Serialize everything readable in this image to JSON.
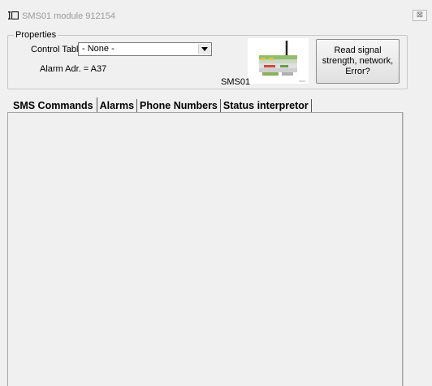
{
  "window": {
    "title": "SMS01 module 912154",
    "close_label": "⊠"
  },
  "properties": {
    "legend": "Properties",
    "control_table_label": "Control Table",
    "control_table_value": "- None -",
    "alarm_address_label": "Alarm Adr. = A37",
    "module_name": "SMS01",
    "read_button_label": "Read signal strength, network, Error?",
    "module_image_icon": "sms-module-icon"
  },
  "tabs": [
    {
      "label": "SMS Commands",
      "active": true
    },
    {
      "label": "Alarms",
      "active": false
    },
    {
      "label": "Phone Numbers",
      "active": false
    },
    {
      "label": "Status interpretor",
      "active": false
    }
  ]
}
